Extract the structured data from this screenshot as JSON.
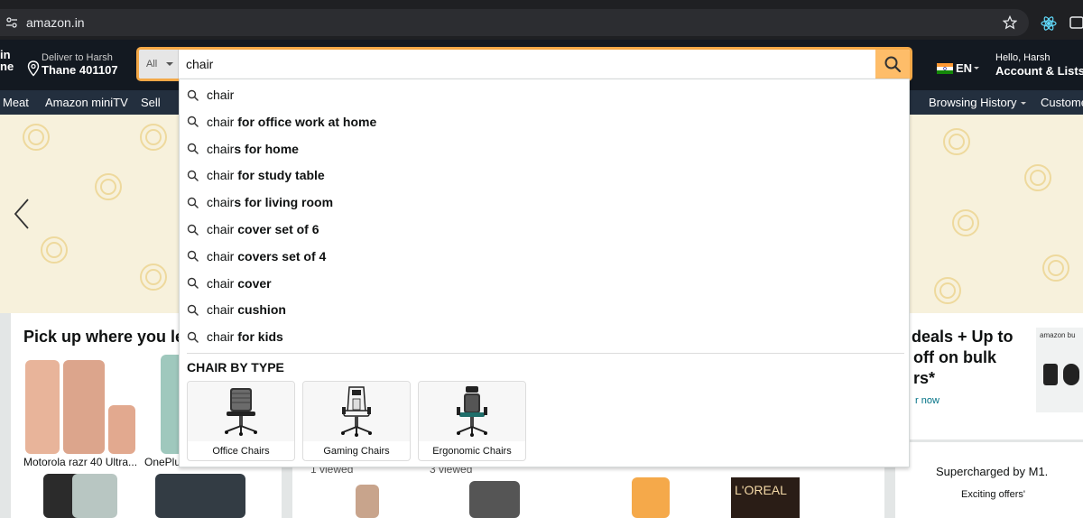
{
  "browser": {
    "url": "amazon.in",
    "icons": [
      "site-settings-icon",
      "star-icon",
      "extension-icon",
      "sidepanel-icon"
    ]
  },
  "header": {
    "logo_fragment": "in\nne",
    "deliver_line1": "Deliver to Harsh",
    "deliver_line2": "Thane 401107",
    "category": "All",
    "search_value": "chair",
    "lang": "EN",
    "account_line1": "Hello, Harsh",
    "account_line2": "Account & Lists"
  },
  "subnav": {
    "items": [
      "Meat",
      "Amazon miniTV",
      "Sell",
      "Browsing History",
      "Custome"
    ]
  },
  "suggestions": [
    {
      "prefix": "chair",
      "rest": ""
    },
    {
      "prefix": "chair",
      "rest": " for office work at home"
    },
    {
      "prefix": "chair",
      "rest": "s for home"
    },
    {
      "prefix": "chair",
      "rest": " for study table"
    },
    {
      "prefix": "chair",
      "rest": "s for living room"
    },
    {
      "prefix": "chair",
      "rest": " cover set of 6"
    },
    {
      "prefix": "chair",
      "rest": " covers set of 4"
    },
    {
      "prefix": "chair",
      "rest": " cover"
    },
    {
      "prefix": "chair",
      "rest": " cushion"
    },
    {
      "prefix": "chair",
      "rest": " for kids"
    }
  ],
  "chair_by_type": {
    "title": "CHAIR BY TYPE",
    "items": [
      "Office Chairs",
      "Gaming Chairs",
      "Ergonomic Chairs"
    ]
  },
  "background": {
    "pickup_title": "Pick up where you le",
    "product1": "Motorola razr 40 Ultra...",
    "product2": "OnePlu",
    "viewed1": "1 viewed",
    "viewed2": "3 viewed",
    "deals_line1": "deals + Up to",
    "deals_line2": "off on bulk",
    "deals_line3": "rs*",
    "deals_link": "r now",
    "promo_brand": "amazon bu",
    "supercharged": "Supercharged by M1.",
    "exciting": "Exciting offers'",
    "brand_tag": "L'OREAL"
  },
  "colors": {
    "nav_bg": "#131921",
    "subnav_bg": "#232f3e",
    "search_border": "#f3a847",
    "search_btn": "#febd69",
    "link_teal": "#007185"
  }
}
